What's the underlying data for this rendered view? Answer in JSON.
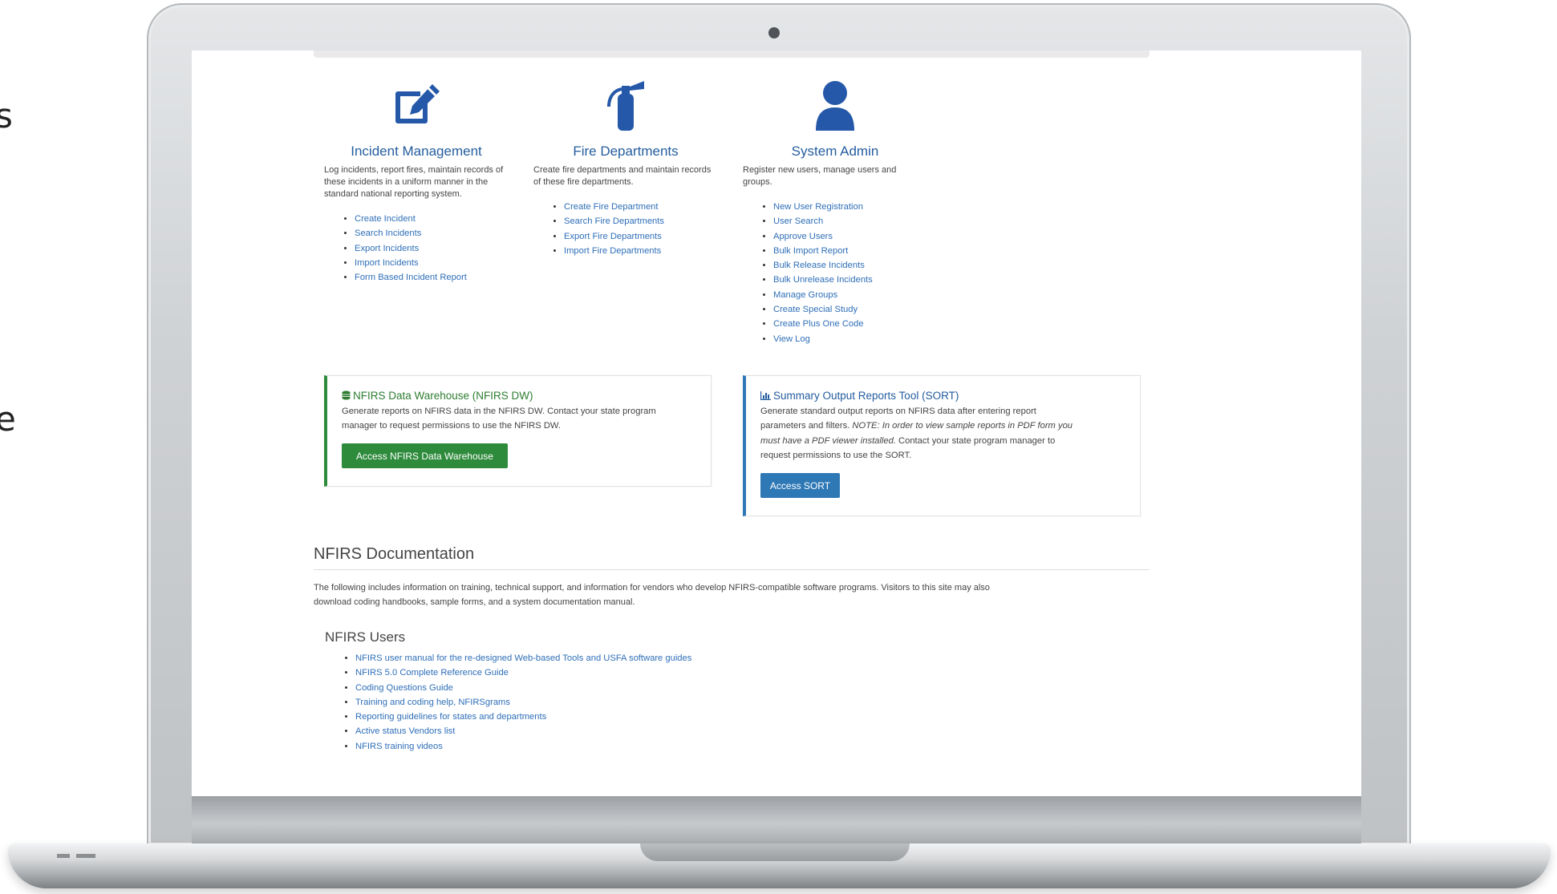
{
  "edge_text": {
    "top": "s",
    "middle": "e"
  },
  "modules": [
    {
      "title": "Incident Management",
      "description": "Log incidents, report fires, maintain records of these incidents in a uniform manner in the standard national reporting system.",
      "icon": "edit-icon",
      "links": [
        "Create Incident",
        "Search Incidents",
        "Export Incidents",
        "Import Incidents",
        "Form Based Incident Report"
      ]
    },
    {
      "title": "Fire Departments",
      "description": "Create fire departments and maintain records of these fire departments.",
      "icon": "fire-extinguisher-icon",
      "links": [
        "Create Fire Department",
        "Search Fire Departments",
        "Export Fire Departments",
        "Import Fire Departments"
      ]
    },
    {
      "title": "System Admin",
      "description": "Register new users, manage users and groups.",
      "icon": "user-icon",
      "links": [
        "New User Registration",
        "User Search",
        "Approve Users",
        "Bulk Import Report",
        "Bulk Release Incidents",
        "Bulk Unrelease Incidents",
        "Manage Groups",
        "Create Special Study",
        "Create Plus One Code",
        "View Log"
      ]
    }
  ],
  "warehouse": {
    "title": "NFIRS Data Warehouse (NFIRS DW)",
    "line1": "Generate reports on NFIRS data in the NFIRS DW. Contact your state program",
    "line2": "manager to request permissions to use the NFIRS DW.",
    "button": "Access NFIRS Data Warehouse",
    "accent": "#2e8b3c"
  },
  "sort": {
    "title": "Summary Output Reports Tool (SORT)",
    "line1": "Generate standard output reports on NFIRS data after entering report",
    "line2a": "parameters and filters.",
    "line2b": "NOTE: In order to view sample reports in PDF form you",
    "line3a": "must have a PDF viewer installed.",
    "line3b": "Contact your state program manager to",
    "line4": "request permissions to use the SORT.",
    "button": "Access SORT",
    "accent": "#2e78b5"
  },
  "documentation": {
    "title": "NFIRS Documentation",
    "line1": "The following includes information on training, technical support, and information for vendors who develop NFIRS-compatible software programs. Visitors to this site may also",
    "line2": "download coding handbooks, sample forms, and a system documentation manual.",
    "users_title": "NFIRS Users",
    "users_links": [
      "NFIRS user manual for the re-designed Web-based Tools and USFA software guides",
      "NFIRS 5.0 Complete Reference Guide",
      "Coding Questions Guide",
      "Training and coding help, NFIRSgrams",
      "Reporting guidelines for states and departments",
      "Active status Vendors list",
      "NFIRS training videos"
    ]
  }
}
